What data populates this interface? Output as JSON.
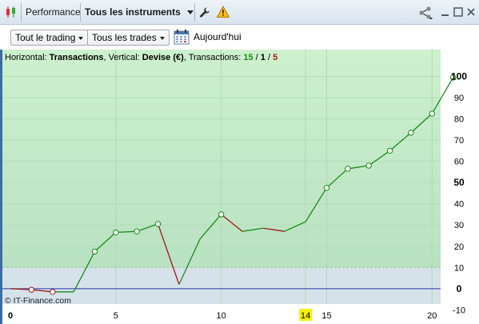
{
  "titlebar": {
    "performance_label": "Performance",
    "instruments_label": "Tous les instruments"
  },
  "filters": {
    "trading_label": "Tout le trading",
    "trades_label": "Tous les trades",
    "date_label": "Aujourd'hui"
  },
  "info": {
    "prefix": "Horizontal: ",
    "x_name": "Transactions",
    "mid": ", Vertical: ",
    "y_name": "Devise (€)",
    "count_prefix": ", Transactions: ",
    "count_total": "15",
    "slash1": " / ",
    "count_mid": "1",
    "slash2": " / ",
    "count_loss": "5"
  },
  "watermark": "© IT-Finance.com",
  "colors": {
    "profit_zone": "#c6ecc6",
    "neutral_zone": "#d6e2ea",
    "loss_zone": "#f3cfd3",
    "up_line": "#1a8a1a",
    "down_line": "#a01616",
    "zero_line": "#2233aa",
    "highlight": "#f5f000"
  },
  "chart_data": {
    "type": "line",
    "xlim": [
      0,
      22
    ],
    "ylim": [
      -11,
      107
    ],
    "x_ticks": [
      0,
      5,
      10,
      15,
      20
    ],
    "x_highlight_tick": 14,
    "y_ticks": [
      100,
      90,
      80,
      70,
      60,
      50,
      40,
      30,
      20,
      10,
      0,
      -10
    ],
    "zones": [
      10,
      -10
    ],
    "points": [
      {
        "x": 0,
        "y": 0,
        "marker": false
      },
      {
        "x": 1,
        "y": -0.5,
        "marker": true
      },
      {
        "x": 2,
        "y": -1.5,
        "marker": true
      },
      {
        "x": 3,
        "y": -1.5,
        "marker": false
      },
      {
        "x": 4,
        "y": 17.5,
        "marker": true
      },
      {
        "x": 5,
        "y": 26.5,
        "marker": true
      },
      {
        "x": 6,
        "y": 27,
        "marker": true
      },
      {
        "x": 7,
        "y": 30.5,
        "marker": true
      },
      {
        "x": 8,
        "y": 2,
        "marker": false
      },
      {
        "x": 9,
        "y": 23.5,
        "marker": false
      },
      {
        "x": 10,
        "y": 35,
        "marker": true
      },
      {
        "x": 11,
        "y": 27,
        "marker": false
      },
      {
        "x": 12,
        "y": 28.5,
        "marker": false
      },
      {
        "x": 13,
        "y": 27,
        "marker": false
      },
      {
        "x": 14,
        "y": 31.5,
        "marker": false
      },
      {
        "x": 15,
        "y": 47.5,
        "marker": true
      },
      {
        "x": 16,
        "y": 56.5,
        "marker": true
      },
      {
        "x": 17,
        "y": 58,
        "marker": true
      },
      {
        "x": 18,
        "y": 65,
        "marker": true
      },
      {
        "x": 19,
        "y": 73.5,
        "marker": true
      },
      {
        "x": 20,
        "y": 82.5,
        "marker": true
      },
      {
        "x": 21,
        "y": 99.5,
        "marker": true
      }
    ]
  }
}
